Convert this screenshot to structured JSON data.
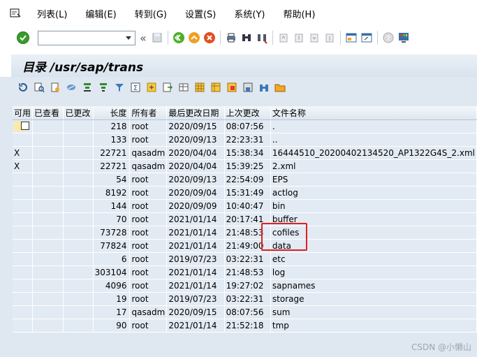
{
  "menu": {
    "items": [
      {
        "label": "列表(L)"
      },
      {
        "label": "编辑(E)"
      },
      {
        "label": "转到(G)"
      },
      {
        "label": "设置(S)"
      },
      {
        "label": "系统(Y)"
      },
      {
        "label": "帮助(H)"
      }
    ]
  },
  "toolbar": {
    "command_value": "",
    "back_label": "«"
  },
  "title": "目录 /usr/sap/trans",
  "table": {
    "columns": [
      "可用",
      "已查看",
      "已更改",
      "长度",
      "所有者",
      "最后更改日期",
      "上次更改",
      "文件名称"
    ],
    "rows": [
      {
        "avail": "",
        "viewed": "",
        "changed": "",
        "len": "218",
        "owner": "root",
        "date": "2020/09/15",
        "time": "08:07:56",
        "name": "."
      },
      {
        "avail": "",
        "viewed": "",
        "changed": "",
        "len": "133",
        "owner": "root",
        "date": "2020/09/13",
        "time": "22:23:31",
        "name": ".."
      },
      {
        "avail": "X",
        "viewed": "",
        "changed": "",
        "len": "22721",
        "owner": "qasadm",
        "date": "2020/04/04",
        "time": "15:38:34",
        "name": "16444510_20200402134520_AP1322G4S_2.xml"
      },
      {
        "avail": "X",
        "viewed": "",
        "changed": "",
        "len": "22721",
        "owner": "qasadm",
        "date": "2020/04/04",
        "time": "15:39:25",
        "name": "2.xml"
      },
      {
        "avail": "",
        "viewed": "",
        "changed": "",
        "len": "54",
        "owner": "root",
        "date": "2020/09/13",
        "time": "22:54:09",
        "name": "EPS"
      },
      {
        "avail": "",
        "viewed": "",
        "changed": "",
        "len": "8192",
        "owner": "root",
        "date": "2020/09/04",
        "time": "15:31:49",
        "name": "actlog"
      },
      {
        "avail": "",
        "viewed": "",
        "changed": "",
        "len": "144",
        "owner": "root",
        "date": "2020/09/09",
        "time": "10:40:47",
        "name": "bin"
      },
      {
        "avail": "",
        "viewed": "",
        "changed": "",
        "len": "70",
        "owner": "root",
        "date": "2021/01/14",
        "time": "20:17:41",
        "name": "buffer"
      },
      {
        "avail": "",
        "viewed": "",
        "changed": "",
        "len": "73728",
        "owner": "root",
        "date": "2021/01/14",
        "time": "21:48:53",
        "name": "cofiles"
      },
      {
        "avail": "",
        "viewed": "",
        "changed": "",
        "len": "77824",
        "owner": "root",
        "date": "2021/01/14",
        "time": "21:49:00",
        "name": "data"
      },
      {
        "avail": "",
        "viewed": "",
        "changed": "",
        "len": "6",
        "owner": "root",
        "date": "2019/07/23",
        "time": "03:22:31",
        "name": "etc"
      },
      {
        "avail": "",
        "viewed": "",
        "changed": "",
        "len": "303104",
        "owner": "root",
        "date": "2021/01/14",
        "time": "21:48:53",
        "name": "log"
      },
      {
        "avail": "",
        "viewed": "",
        "changed": "",
        "len": "4096",
        "owner": "root",
        "date": "2021/01/14",
        "time": "19:27:02",
        "name": "sapnames"
      },
      {
        "avail": "",
        "viewed": "",
        "changed": "",
        "len": "19",
        "owner": "root",
        "date": "2019/07/23",
        "time": "03:22:31",
        "name": "storage"
      },
      {
        "avail": "",
        "viewed": "",
        "changed": "",
        "len": "17",
        "owner": "qasadm",
        "date": "2020/09/15",
        "time": "08:07:56",
        "name": "sum"
      },
      {
        "avail": "",
        "viewed": "",
        "changed": "",
        "len": "90",
        "owner": "root",
        "date": "2021/01/14",
        "time": "21:52:18",
        "name": "tmp"
      }
    ]
  },
  "watermark": "CSDN @小懒山",
  "colors": {
    "highlight": "#e02020",
    "ok_green": "#3a9b2c"
  }
}
